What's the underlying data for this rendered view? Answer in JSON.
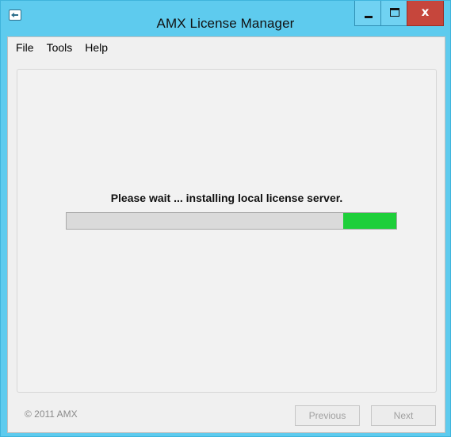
{
  "window": {
    "title": "AMX License Manager"
  },
  "caption_buttons": {
    "minimize_icon": "minimize-icon",
    "maximize_icon": "maximize-icon",
    "close_icon": "close-icon",
    "close_glyph": "x"
  },
  "menu": {
    "items": [
      "File",
      "Tools",
      "Help"
    ]
  },
  "main": {
    "status_text": "Please wait ... installing local license server.",
    "progress": {
      "segment_start": 0.84,
      "segment_end": 1.0,
      "fill_color": "#1ecf3a",
      "track_color": "#dadada"
    }
  },
  "footer": {
    "copyright": "© 2011 AMX",
    "previous_label": "Previous",
    "next_label": "Next"
  },
  "colors": {
    "titlebar": "#5ecbee",
    "close_button": "#c6463c"
  }
}
